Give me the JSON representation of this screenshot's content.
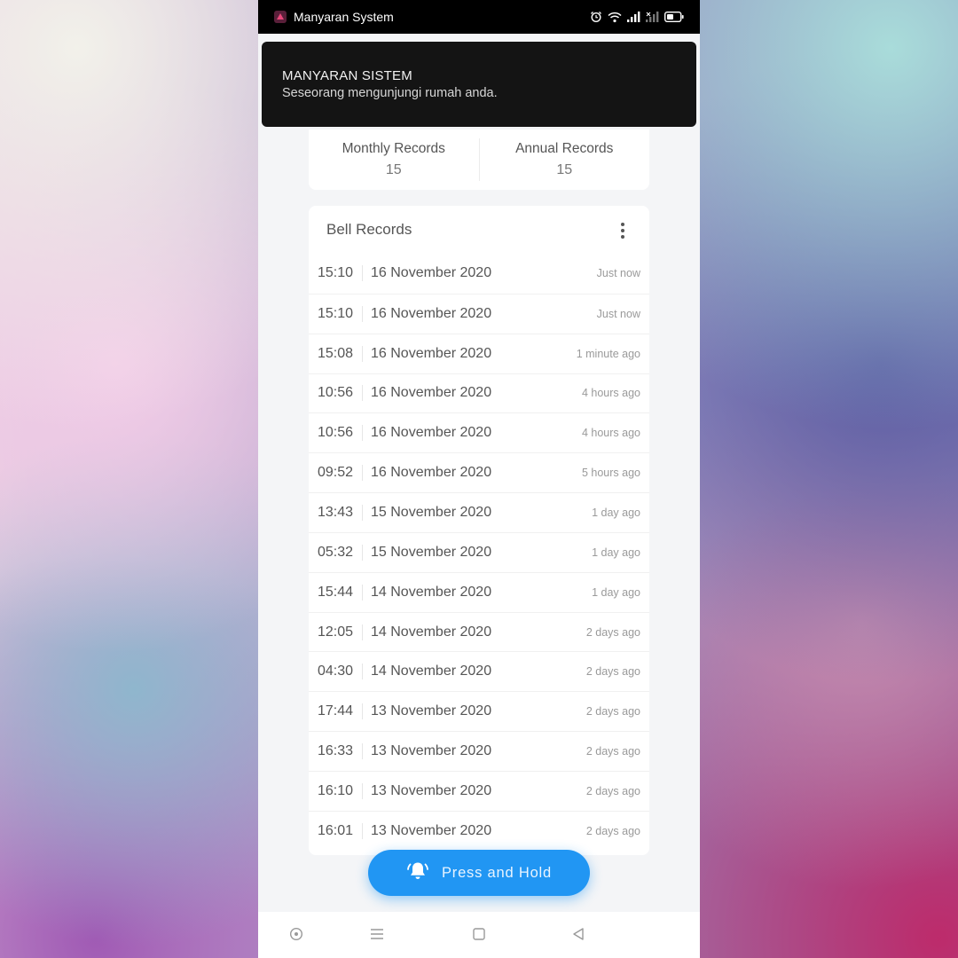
{
  "status_bar": {
    "app_name": "Manyaran System"
  },
  "notification": {
    "title": "MANYARAN SISTEM",
    "body": "Seseorang mengunjungi rumah anda."
  },
  "summary": {
    "monthly_label": "Monthly Records",
    "monthly_value": "15",
    "annual_label": "Annual Records",
    "annual_value": "15"
  },
  "records": {
    "title": "Bell Records",
    "items": [
      {
        "time": "15:10",
        "date": "16 November 2020",
        "ago": "Just now"
      },
      {
        "time": "15:10",
        "date": "16 November 2020",
        "ago": "Just now"
      },
      {
        "time": "15:08",
        "date": "16 November 2020",
        "ago": "1 minute ago"
      },
      {
        "time": "10:56",
        "date": "16 November 2020",
        "ago": "4 hours ago"
      },
      {
        "time": "10:56",
        "date": "16 November 2020",
        "ago": "4 hours ago"
      },
      {
        "time": "09:52",
        "date": "16 November 2020",
        "ago": "5 hours ago"
      },
      {
        "time": "13:43",
        "date": "15 November 2020",
        "ago": "1 day ago"
      },
      {
        "time": "05:32",
        "date": "15 November 2020",
        "ago": "1 day ago"
      },
      {
        "time": "15:44",
        "date": "14 November 2020",
        "ago": "1 day ago"
      },
      {
        "time": "12:05",
        "date": "14 November 2020",
        "ago": "2 days ago"
      },
      {
        "time": "04:30",
        "date": "14 November 2020",
        "ago": "2 days ago"
      },
      {
        "time": "17:44",
        "date": "13 November 2020",
        "ago": "2 days ago"
      },
      {
        "time": "16:33",
        "date": "13 November 2020",
        "ago": "2 days ago"
      },
      {
        "time": "16:10",
        "date": "13 November 2020",
        "ago": "2 days ago"
      },
      {
        "time": "16:01",
        "date": "13 November 2020",
        "ago": "2 days ago"
      }
    ]
  },
  "action_button": {
    "label": "Press and Hold",
    "icon": "bell-icon"
  },
  "nav": {
    "icons": [
      "dot-circle-icon",
      "menu-icon",
      "square-icon",
      "back-triangle-icon"
    ]
  },
  "colors": {
    "accent": "#2196f3",
    "notification_bg": "#141414",
    "background": "#f4f5f7"
  }
}
